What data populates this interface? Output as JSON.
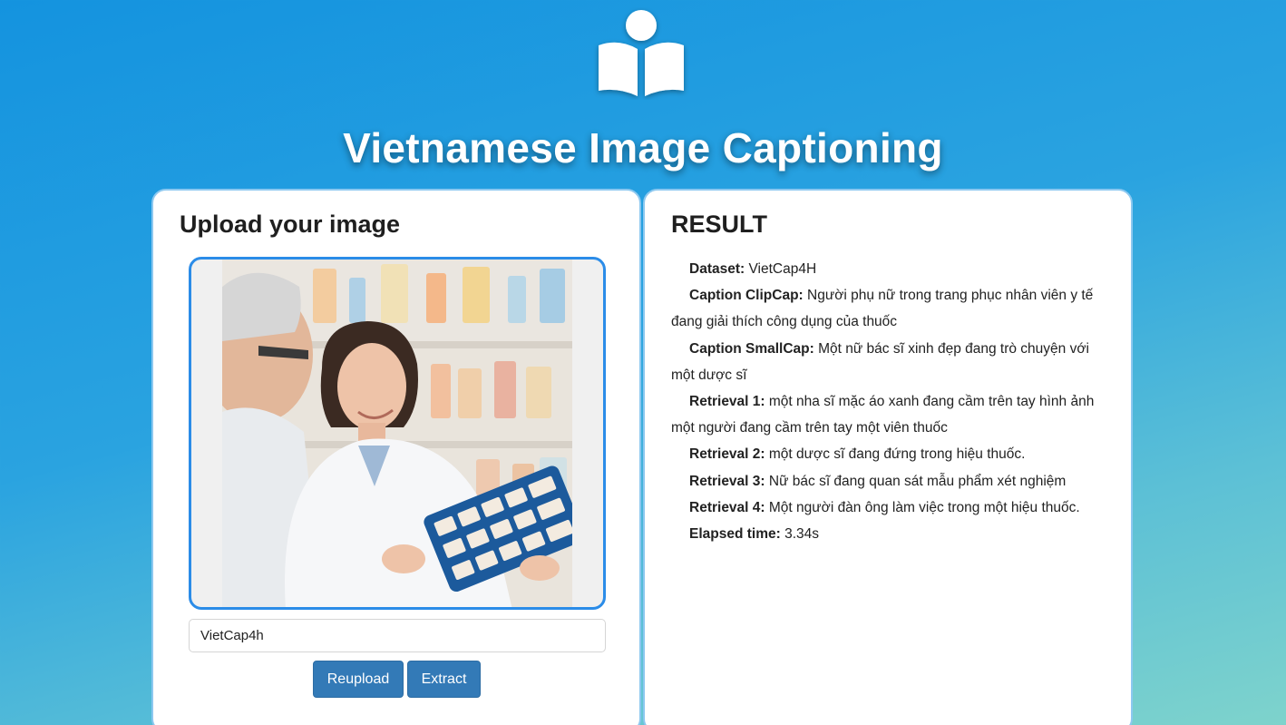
{
  "header": {
    "logo_icon": "person-reading-book-icon",
    "title": "Vietnamese Image Captioning"
  },
  "upload": {
    "heading": "Upload your image",
    "image_alt": "pharmacist smiling holding a pill organizer next to an older man",
    "dataset_value": "VietCap4h",
    "reupload_label": "Reupload",
    "extract_label": "Extract"
  },
  "result": {
    "heading": "RESULT",
    "items": [
      {
        "label": "Dataset:",
        "value": "VietCap4H"
      },
      {
        "label": "Caption ClipCap:",
        "value": "Người phụ nữ trong trang phục nhân viên y tế đang giải thích công dụng của thuốc"
      },
      {
        "label": "Caption SmallCap:",
        "value": "Một nữ bác sĩ xinh đẹp đang trò chuyện với một dược sĩ"
      },
      {
        "label": "Retrieval 1:",
        "value": "một nha sĩ mặc áo xanh đang cầm trên tay hình ảnh một người đang cầm trên tay một viên thuốc"
      },
      {
        "label": "Retrieval 2:",
        "value": "một dược sĩ đang đứng trong hiệu thuốc."
      },
      {
        "label": "Retrieval 3:",
        "value": "Nữ bác sĩ đang quan sát mẫu phẩm xét nghiệm"
      },
      {
        "label": "Retrieval 4:",
        "value": "Một người đàn ông làm việc trong một hiệu thuốc."
      },
      {
        "label": "Elapsed time:",
        "value": "3.34s"
      }
    ]
  },
  "colors": {
    "primary_button": "#337ab7",
    "image_frame_border": "#2b8ce8",
    "background_top": "#1493df",
    "background_bottom": "#7ed3cc"
  }
}
